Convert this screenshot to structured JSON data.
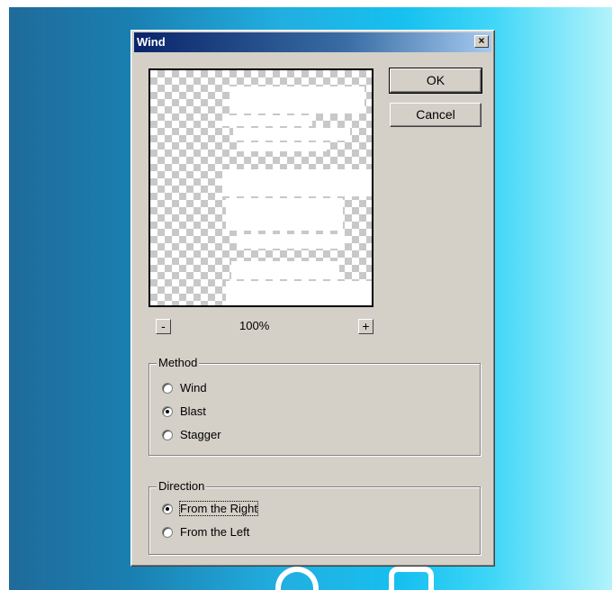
{
  "dialog": {
    "title": "Wind",
    "close_glyph": "×",
    "buttons": {
      "ok": "OK",
      "cancel": "Cancel"
    },
    "zoom": {
      "minus": "-",
      "plus": "+",
      "level": "100%"
    },
    "method": {
      "label": "Method",
      "options": [
        "Wind",
        "Blast",
        "Stagger"
      ],
      "selected": "Blast"
    },
    "direction": {
      "label": "Direction",
      "options": [
        "From the Right",
        "From the Left"
      ],
      "selected": "From the Right"
    }
  },
  "icons": [
    "close-icon",
    "minus-icon",
    "plus-icon"
  ],
  "colors": {
    "titlebar_start": "#0a246a",
    "titlebar_end": "#a6caf0",
    "dialog_face": "#d4d0c8"
  }
}
